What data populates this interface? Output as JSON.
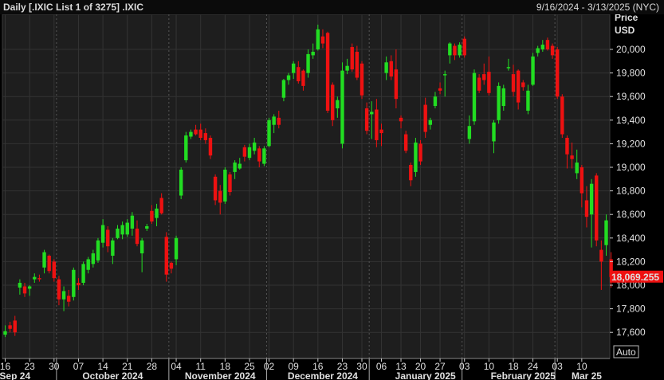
{
  "header": {
    "title": "Daily [.IXIC List 1 of 3275] .IXIC",
    "range": "9/16/2024 - 3/13/2025 (NYC)"
  },
  "colors": {
    "up": "#22dd22",
    "down": "#ee1111",
    "grid": "#333333",
    "last_price_bg": "#ee1111"
  },
  "chart_data": {
    "type": "candlestick",
    "y_axis_title": [
      "Price",
      "USD"
    ],
    "ylim": [
      17500,
      20250
    ],
    "y_ticks": [
      17600,
      17800,
      18000,
      18200,
      18400,
      18600,
      18800,
      19000,
      19200,
      19400,
      19600,
      19800,
      20000
    ],
    "y_tick_labels": [
      "17,600",
      "17,800",
      "18,000",
      "18,200",
      "18,400",
      "18,600",
      "18,800",
      "19,000",
      "19,200",
      "19,400",
      "19,600",
      "19,800",
      "20,000"
    ],
    "last_price_label": "18,069.255",
    "last_price": 18069.255,
    "auto_label": "Auto",
    "x_day_ticks": [
      {
        "i": 0,
        "label": "16"
      },
      {
        "i": 5,
        "label": "23"
      },
      {
        "i": 10,
        "label": "30"
      },
      {
        "i": 15,
        "label": "07"
      },
      {
        "i": 20,
        "label": "14"
      },
      {
        "i": 25,
        "label": "21"
      },
      {
        "i": 30,
        "label": "28"
      },
      {
        "i": 35,
        "label": "04"
      },
      {
        "i": 40,
        "label": "11"
      },
      {
        "i": 45,
        "label": "18"
      },
      {
        "i": 50,
        "label": "25"
      },
      {
        "i": 54,
        "label": "02"
      },
      {
        "i": 59,
        "label": "09"
      },
      {
        "i": 64,
        "label": "16"
      },
      {
        "i": 69,
        "label": "23"
      },
      {
        "i": 73,
        "label": "30"
      },
      {
        "i": 77,
        "label": "06"
      },
      {
        "i": 81,
        "label": "13"
      },
      {
        "i": 85,
        "label": "20"
      },
      {
        "i": 89,
        "label": "27"
      },
      {
        "i": 94,
        "label": "03"
      },
      {
        "i": 99,
        "label": "10"
      },
      {
        "i": 104,
        "label": "18"
      },
      {
        "i": 108,
        "label": "24"
      },
      {
        "i": 113,
        "label": "03"
      },
      {
        "i": 118,
        "label": "10"
      }
    ],
    "x_month_ticks": [
      {
        "i": 2,
        "label": "Sep 24"
      },
      {
        "i": 22,
        "label": "October 2024"
      },
      {
        "i": 44,
        "label": "November 2024"
      },
      {
        "i": 65,
        "label": "December 2024"
      },
      {
        "i": 86,
        "label": "January 2025"
      },
      {
        "i": 106,
        "label": "February 2025"
      },
      {
        "i": 119,
        "label": "Mar 25"
      }
    ],
    "month_separators": [
      10.5,
      33.5,
      53.5,
      74.5,
      93.5,
      112.5
    ],
    "candles": [
      {
        "o": 17580,
        "h": 17660,
        "l": 17560,
        "c": 17610
      },
      {
        "o": 17660,
        "h": 17690,
        "l": 17600,
        "c": 17630
      },
      {
        "o": 17700,
        "h": 17740,
        "l": 17570,
        "c": 17600
      },
      {
        "o": 17980,
        "h": 18050,
        "l": 17920,
        "c": 18020
      },
      {
        "o": 17990,
        "h": 18020,
        "l": 17900,
        "c": 17930
      },
      {
        "o": 17970,
        "h": 18000,
        "l": 17910,
        "c": 17990
      },
      {
        "o": 18050,
        "h": 18100,
        "l": 18020,
        "c": 18070
      },
      {
        "o": 18060,
        "h": 18090,
        "l": 18030,
        "c": 18050
      },
      {
        "o": 18150,
        "h": 18300,
        "l": 18100,
        "c": 18280
      },
      {
        "o": 18250,
        "h": 18260,
        "l": 18100,
        "c": 18120
      },
      {
        "o": 18200,
        "h": 18220,
        "l": 18030,
        "c": 18060
      },
      {
        "o": 18050,
        "h": 18080,
        "l": 17830,
        "c": 17880
      },
      {
        "o": 17880,
        "h": 17990,
        "l": 17780,
        "c": 17950
      },
      {
        "o": 17910,
        "h": 17960,
        "l": 17820,
        "c": 17860
      },
      {
        "o": 17900,
        "h": 18150,
        "l": 17870,
        "c": 18130
      },
      {
        "o": 18020,
        "h": 18060,
        "l": 17960,
        "c": 18000
      },
      {
        "o": 18020,
        "h": 18200,
        "l": 18000,
        "c": 18180
      },
      {
        "o": 18130,
        "h": 18240,
        "l": 18100,
        "c": 18220
      },
      {
        "o": 18180,
        "h": 18300,
        "l": 18150,
        "c": 18270
      },
      {
        "o": 18210,
        "h": 18400,
        "l": 18190,
        "c": 18380
      },
      {
        "o": 18360,
        "h": 18560,
        "l": 18320,
        "c": 18510
      },
      {
        "o": 18470,
        "h": 18500,
        "l": 18280,
        "c": 18330
      },
      {
        "o": 18250,
        "h": 18400,
        "l": 18180,
        "c": 18380
      },
      {
        "o": 18400,
        "h": 18510,
        "l": 18390,
        "c": 18480
      },
      {
        "o": 18430,
        "h": 18540,
        "l": 18390,
        "c": 18510
      },
      {
        "o": 18430,
        "h": 18560,
        "l": 18410,
        "c": 18530
      },
      {
        "o": 18480,
        "h": 18620,
        "l": 18420,
        "c": 18590
      },
      {
        "o": 18480,
        "h": 18550,
        "l": 18330,
        "c": 18350
      },
      {
        "o": 18270,
        "h": 18400,
        "l": 18110,
        "c": 18380
      },
      {
        "o": 18480,
        "h": 18520,
        "l": 18460,
        "c": 18500
      },
      {
        "o": 18630,
        "h": 18680,
        "l": 18520,
        "c": 18540
      },
      {
        "o": 18570,
        "h": 18690,
        "l": 18500,
        "c": 18650
      },
      {
        "o": 18740,
        "h": 18780,
        "l": 18600,
        "c": 18610
      },
      {
        "o": 18410,
        "h": 18450,
        "l": 18030,
        "c": 18090
      },
      {
        "o": 18190,
        "h": 18200,
        "l": 18100,
        "c": 18140
      },
      {
        "o": 18220,
        "h": 18420,
        "l": 18170,
        "c": 18400
      },
      {
        "o": 18760,
        "h": 19000,
        "l": 18730,
        "c": 18980
      },
      {
        "o": 19060,
        "h": 19300,
        "l": 19040,
        "c": 19270
      },
      {
        "o": 19260,
        "h": 19320,
        "l": 19240,
        "c": 19300
      },
      {
        "o": 19320,
        "h": 19360,
        "l": 19270,
        "c": 19280
      },
      {
        "o": 19320,
        "h": 19370,
        "l": 19230,
        "c": 19250
      },
      {
        "o": 19290,
        "h": 19330,
        "l": 19200,
        "c": 19230
      },
      {
        "o": 19250,
        "h": 19270,
        "l": 19070,
        "c": 19100
      },
      {
        "o": 18920,
        "h": 18940,
        "l": 18680,
        "c": 18720
      },
      {
        "o": 18800,
        "h": 18850,
        "l": 18600,
        "c": 18700
      },
      {
        "o": 18710,
        "h": 19000,
        "l": 18690,
        "c": 18980
      },
      {
        "o": 18940,
        "h": 18960,
        "l": 18760,
        "c": 18790
      },
      {
        "o": 18960,
        "h": 19060,
        "l": 18900,
        "c": 19040
      },
      {
        "o": 18990,
        "h": 19080,
        "l": 18980,
        "c": 19030
      },
      {
        "o": 19170,
        "h": 19190,
        "l": 19050,
        "c": 19090
      },
      {
        "o": 19080,
        "h": 19200,
        "l": 19060,
        "c": 19170
      },
      {
        "o": 19140,
        "h": 19250,
        "l": 19110,
        "c": 19210
      },
      {
        "o": 19160,
        "h": 19180,
        "l": 19000,
        "c": 19050
      },
      {
        "o": 19030,
        "h": 19180,
        "l": 19010,
        "c": 19160
      },
      {
        "o": 19180,
        "h": 19420,
        "l": 19170,
        "c": 19400
      },
      {
        "o": 19360,
        "h": 19450,
        "l": 19290,
        "c": 19430
      },
      {
        "o": 19420,
        "h": 19480,
        "l": 19330,
        "c": 19360
      },
      {
        "o": 19590,
        "h": 19750,
        "l": 19560,
        "c": 19740
      },
      {
        "o": 19740,
        "h": 19800,
        "l": 19700,
        "c": 19780
      },
      {
        "o": 19800,
        "h": 19900,
        "l": 19750,
        "c": 19880
      },
      {
        "o": 19850,
        "h": 19900,
        "l": 19710,
        "c": 19730
      },
      {
        "o": 19820,
        "h": 19830,
        "l": 19650,
        "c": 19690
      },
      {
        "o": 19800,
        "h": 20000,
        "l": 19760,
        "c": 19960
      },
      {
        "o": 19950,
        "h": 20050,
        "l": 19920,
        "c": 19980
      },
      {
        "o": 20000,
        "h": 20210,
        "l": 19990,
        "c": 20170
      },
      {
        "o": 20110,
        "h": 20170,
        "l": 20010,
        "c": 20050
      },
      {
        "o": 20140,
        "h": 20150,
        "l": 19460,
        "c": 19480
      },
      {
        "o": 19700,
        "h": 19720,
        "l": 19350,
        "c": 19400
      },
      {
        "o": 19500,
        "h": 19600,
        "l": 19420,
        "c": 19570
      },
      {
        "o": 19200,
        "h": 19890,
        "l": 19160,
        "c": 19820
      },
      {
        "o": 19820,
        "h": 19920,
        "l": 19790,
        "c": 19860
      },
      {
        "o": 20020,
        "h": 20050,
        "l": 19810,
        "c": 19830
      },
      {
        "o": 19980,
        "h": 20030,
        "l": 19740,
        "c": 19760
      },
      {
        "o": 19880,
        "h": 19900,
        "l": 19580,
        "c": 19610
      },
      {
        "o": 19500,
        "h": 19550,
        "l": 19280,
        "c": 19310
      },
      {
        "o": 19450,
        "h": 19560,
        "l": 19240,
        "c": 19470
      },
      {
        "o": 19490,
        "h": 19580,
        "l": 19170,
        "c": 19230
      },
      {
        "o": 19320,
        "h": 19370,
        "l": 19180,
        "c": 19290
      },
      {
        "o": 19800,
        "h": 19940,
        "l": 19740,
        "c": 19890
      },
      {
        "o": 19900,
        "h": 19950,
        "l": 19740,
        "c": 19770
      },
      {
        "o": 19830,
        "h": 20000,
        "l": 19500,
        "c": 19580
      },
      {
        "o": 19420,
        "h": 19440,
        "l": 19330,
        "c": 19390
      },
      {
        "o": 19280,
        "h": 19310,
        "l": 19120,
        "c": 19140
      },
      {
        "o": 19020,
        "h": 19040,
        "l": 18840,
        "c": 18890
      },
      {
        "o": 18960,
        "h": 19250,
        "l": 18920,
        "c": 19210
      },
      {
        "o": 19200,
        "h": 19230,
        "l": 19020,
        "c": 19050
      },
      {
        "o": 19530,
        "h": 19590,
        "l": 19250,
        "c": 19300
      },
      {
        "o": 19360,
        "h": 19420,
        "l": 19320,
        "c": 19400
      },
      {
        "o": 19520,
        "h": 19640,
        "l": 19500,
        "c": 19600
      },
      {
        "o": 19670,
        "h": 19720,
        "l": 19620,
        "c": 19650
      },
      {
        "o": 19780,
        "h": 19820,
        "l": 19600,
        "c": 19790
      },
      {
        "o": 19950,
        "h": 20060,
        "l": 19880,
        "c": 20050
      },
      {
        "o": 20030,
        "h": 20050,
        "l": 19910,
        "c": 19950
      },
      {
        "o": 19950,
        "h": 20060,
        "l": 19930,
        "c": 20040
      },
      {
        "o": 20090,
        "h": 20110,
        "l": 19930,
        "c": 19950
      },
      {
        "o": 19240,
        "h": 19440,
        "l": 19200,
        "c": 19350
      },
      {
        "o": 19390,
        "h": 19830,
        "l": 19360,
        "c": 19800
      },
      {
        "o": 19760,
        "h": 19790,
        "l": 19630,
        "c": 19650
      },
      {
        "o": 19790,
        "h": 19880,
        "l": 19700,
        "c": 19740
      },
      {
        "o": 19810,
        "h": 19940,
        "l": 19610,
        "c": 19630
      },
      {
        "o": 19220,
        "h": 19400,
        "l": 19120,
        "c": 19380
      },
      {
        "o": 19400,
        "h": 19720,
        "l": 19370,
        "c": 19690
      },
      {
        "o": 19520,
        "h": 19700,
        "l": 19480,
        "c": 19670
      },
      {
        "o": 19840,
        "h": 19920,
        "l": 19820,
        "c": 19850
      },
      {
        "o": 19790,
        "h": 19870,
        "l": 19600,
        "c": 19640
      },
      {
        "o": 19820,
        "h": 19830,
        "l": 19490,
        "c": 19550
      },
      {
        "o": 19720,
        "h": 19740,
        "l": 19650,
        "c": 19680
      },
      {
        "o": 19480,
        "h": 19700,
        "l": 19450,
        "c": 19650
      },
      {
        "o": 19700,
        "h": 19970,
        "l": 19690,
        "c": 19940
      },
      {
        "o": 19970,
        "h": 20030,
        "l": 19940,
        "c": 20010
      },
      {
        "o": 20000,
        "h": 20080,
        "l": 19980,
        "c": 20040
      },
      {
        "o": 20080,
        "h": 20100,
        "l": 19990,
        "c": 20000
      },
      {
        "o": 20030,
        "h": 20050,
        "l": 19920,
        "c": 19950
      },
      {
        "o": 20000,
        "h": 20020,
        "l": 19580,
        "c": 19600
      },
      {
        "o": 19600,
        "h": 19620,
        "l": 19250,
        "c": 19280
      },
      {
        "o": 19250,
        "h": 19270,
        "l": 18990,
        "c": 19110
      },
      {
        "o": 19100,
        "h": 19210,
        "l": 18990,
        "c": 19070
      },
      {
        "o": 18950,
        "h": 19150,
        "l": 18900,
        "c": 19040
      },
      {
        "o": 19000,
        "h": 19020,
        "l": 18660,
        "c": 18780
      },
      {
        "o": 18720,
        "h": 18840,
        "l": 18490,
        "c": 18580
      },
      {
        "o": 18600,
        "h": 18900,
        "l": 18320,
        "c": 18860
      },
      {
        "o": 18930,
        "h": 18950,
        "l": 18330,
        "c": 18380
      },
      {
        "o": 18300,
        "h": 18380,
        "l": 17960,
        "c": 18200
      },
      {
        "o": 18340,
        "h": 18600,
        "l": 18250,
        "c": 18550
      },
      {
        "o": 18220,
        "h": 18280,
        "l": 17980,
        "c": 18069
      }
    ]
  }
}
